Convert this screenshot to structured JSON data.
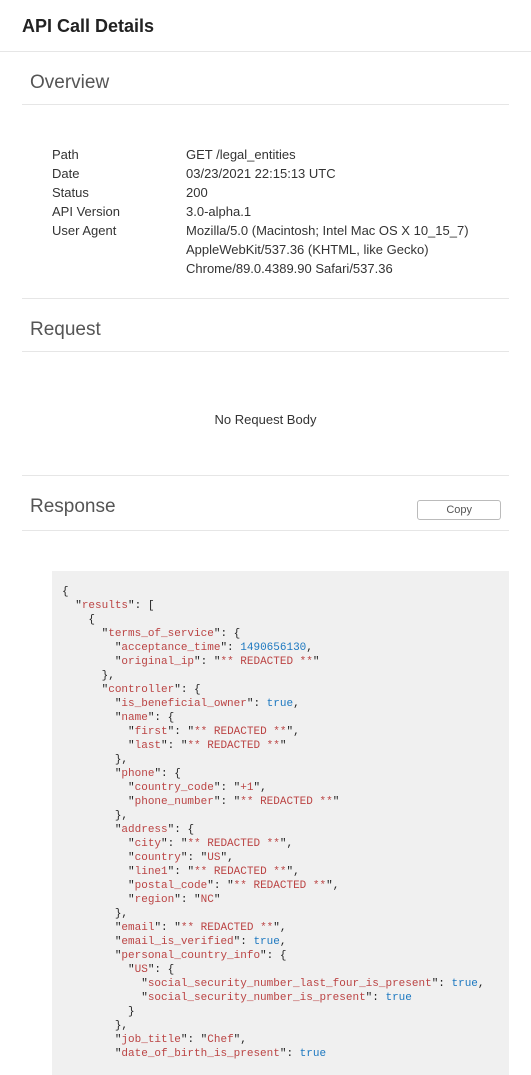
{
  "page_title": "API Call Details",
  "overview": {
    "heading": "Overview",
    "rows": [
      {
        "label": "Path",
        "value": "GET /legal_entities"
      },
      {
        "label": "Date",
        "value": "03/23/2021 22:15:13 UTC"
      },
      {
        "label": "Status",
        "value": "200"
      },
      {
        "label": "API Version",
        "value": "3.0-alpha.1"
      },
      {
        "label": "User Agent",
        "value": "Mozilla/5.0 (Macintosh; Intel Mac OS X 10_15_7) AppleWebKit/537.36 (KHTML, like Gecko) Chrome/89.0.4389.90 Safari/537.36"
      }
    ]
  },
  "request": {
    "heading": "Request",
    "empty_text": "No Request Body"
  },
  "response": {
    "heading": "Response",
    "copy_label": "Copy",
    "body": {
      "results": [
        {
          "terms_of_service": {
            "acceptance_time": 1490656130,
            "original_ip": "** REDACTED **"
          },
          "controller": {
            "is_beneficial_owner": true,
            "name": {
              "first": "** REDACTED **",
              "last": "** REDACTED **"
            },
            "phone": {
              "country_code": "+1",
              "phone_number": "** REDACTED **"
            },
            "address": {
              "city": "** REDACTED **",
              "country": "US",
              "line1": "** REDACTED **",
              "postal_code": "** REDACTED **",
              "region": "NC"
            },
            "email": "** REDACTED **",
            "email_is_verified": true,
            "personal_country_info": {
              "US": {
                "social_security_number_last_four_is_present": true,
                "social_security_number_is_present": true
              }
            },
            "job_title": "Chef",
            "date_of_birth_is_present": true
          }
        }
      ]
    }
  },
  "chart_data": null
}
